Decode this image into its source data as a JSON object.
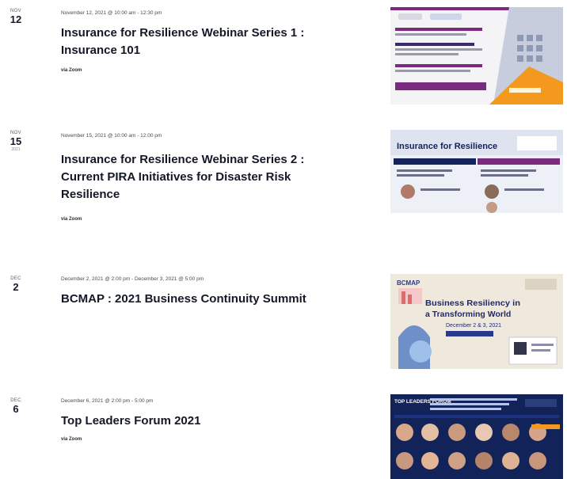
{
  "events": [
    {
      "month": "Nov",
      "day": "12",
      "year": "",
      "datetime": "November 12, 2021 @ 10:00 am - 12:30 pm",
      "title": "Insurance for Resilience Webinar Series 1 : Insurance 101",
      "venue": "via Zoom",
      "image": "event-poster-1"
    },
    {
      "month": "Nov",
      "day": "15",
      "year": "2021",
      "datetime": "November 15, 2021 @ 10:00 am - 12:00 pm",
      "title": "Insurance for Resilience Webinar Series 2 : Current PIRA Initiatives for Disaster Risk Resilience",
      "venue": "via Zoom",
      "image": "event-poster-2"
    },
    {
      "month": "Dec",
      "day": "2",
      "year": "",
      "datetime": "December 2, 2021 @ 2:00 pm - December 3, 2021 @ 5:00 pm",
      "title": "BCMAP : 2021 Business Continuity Summit",
      "venue": "",
      "image": "event-poster-3"
    },
    {
      "month": "Dec",
      "day": "6",
      "year": "",
      "datetime": "December 6, 2021 @ 2:00 pm - 5:00 pm",
      "title": "Top Leaders Forum 2021",
      "venue": "via Zoom",
      "image": "event-poster-4"
    }
  ],
  "posters": {
    "p2_heading": "Insurance for Resilience",
    "p3_heading": "Business Resiliency in a Transforming World",
    "p3_dates": "December 2 & 3, 2021",
    "p3_logo": "BCMAP",
    "p4_heading": "TOP LEADERS FORUM"
  },
  "colors": {
    "text": "#141827",
    "meta": "#4a4a4a",
    "poster_purple": "#7a2a7f",
    "poster_navy": "#12235a",
    "poster_orange": "#f39a1e"
  }
}
